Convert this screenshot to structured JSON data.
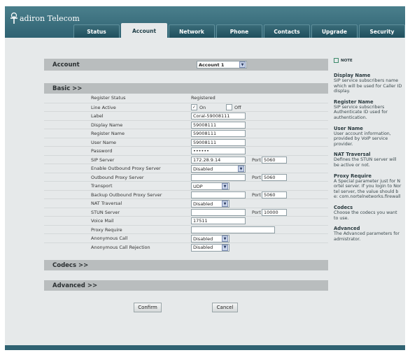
{
  "brand": {
    "logo_text": "adiron Telecom",
    "logo_initial": "T"
  },
  "tabs": [
    "Status",
    "Account",
    "Network",
    "Phone",
    "Contacts",
    "Upgrade",
    "Security"
  ],
  "account_section": {
    "label": "Account",
    "selected": "Account 1"
  },
  "basic": {
    "heading": "Basic >>",
    "fields": {
      "register_status": {
        "label": "Register Status",
        "value": "Registered"
      },
      "line_active": {
        "label": "Line Active",
        "on": "On",
        "off": "Off",
        "checked": "on"
      },
      "label": {
        "label": "Label",
        "value": "Coral-59008111"
      },
      "display_name": {
        "label": "Display Name",
        "value": "59008111"
      },
      "register_name": {
        "label": "Register Name",
        "value": "59008111"
      },
      "user_name": {
        "label": "User Name",
        "value": "59008111"
      },
      "password": {
        "label": "Password",
        "value": "••••••"
      },
      "sip_server": {
        "label": "SIP Server",
        "value": "172.28.9.14",
        "port_label": "Port",
        "port": "5060"
      },
      "enable_outbound_proxy": {
        "label": "Enable Outbound Proxy Server",
        "value": "Disabled"
      },
      "outbound_proxy": {
        "label": "Outbound Proxy Server",
        "value": "",
        "port_label": "Port",
        "port": "5060"
      },
      "transport": {
        "label": "Transport",
        "value": "UDP"
      },
      "backup_outbound_proxy": {
        "label": "Backup Outbound Proxy Server",
        "value": "",
        "port_label": "Port",
        "port": "5060"
      },
      "nat_traversal": {
        "label": "NAT Traversal",
        "value": "Disabled"
      },
      "stun_server": {
        "label": "STUN Server",
        "value": "",
        "port_label": "Port",
        "port": "10000"
      },
      "voice_mail": {
        "label": "Voice Mail",
        "value": "17511"
      },
      "proxy_require": {
        "label": "Proxy Require",
        "value": ""
      },
      "anonymous_call": {
        "label": "Anonymous Call",
        "value": "Disabled"
      },
      "anonymous_call_rejection": {
        "label": "Anonymous Call Rejection",
        "value": "Disabled"
      }
    }
  },
  "codecs": {
    "heading": "Codecs >>"
  },
  "advanced": {
    "heading": "Advanced >>"
  },
  "buttons": {
    "confirm": "Confirm",
    "cancel": "Cancel"
  },
  "note": {
    "title": "NOTE",
    "items": [
      {
        "heading": "Display Name",
        "text": "SIP service subscribers name which will be used for Caller ID display."
      },
      {
        "heading": "Register Name",
        "text": "SIP service subscribers Authenticate ID used for authentication."
      },
      {
        "heading": "User Name",
        "text": "User account information, provided by VoIP service provider."
      },
      {
        "heading": "NAT Traversal",
        "text": "Defines the STUN server will be active or not."
      },
      {
        "heading": "Proxy Require",
        "text": "A Special parameter just for Nortel server. If you login to Nortel server, the value should be: com.nortelnetworks.firewall"
      },
      {
        "heading": "Codecs",
        "text": "Choose the codecs you want to use."
      },
      {
        "heading": "Advanced",
        "text": "The Advanced parameters for admistrator."
      }
    ]
  }
}
